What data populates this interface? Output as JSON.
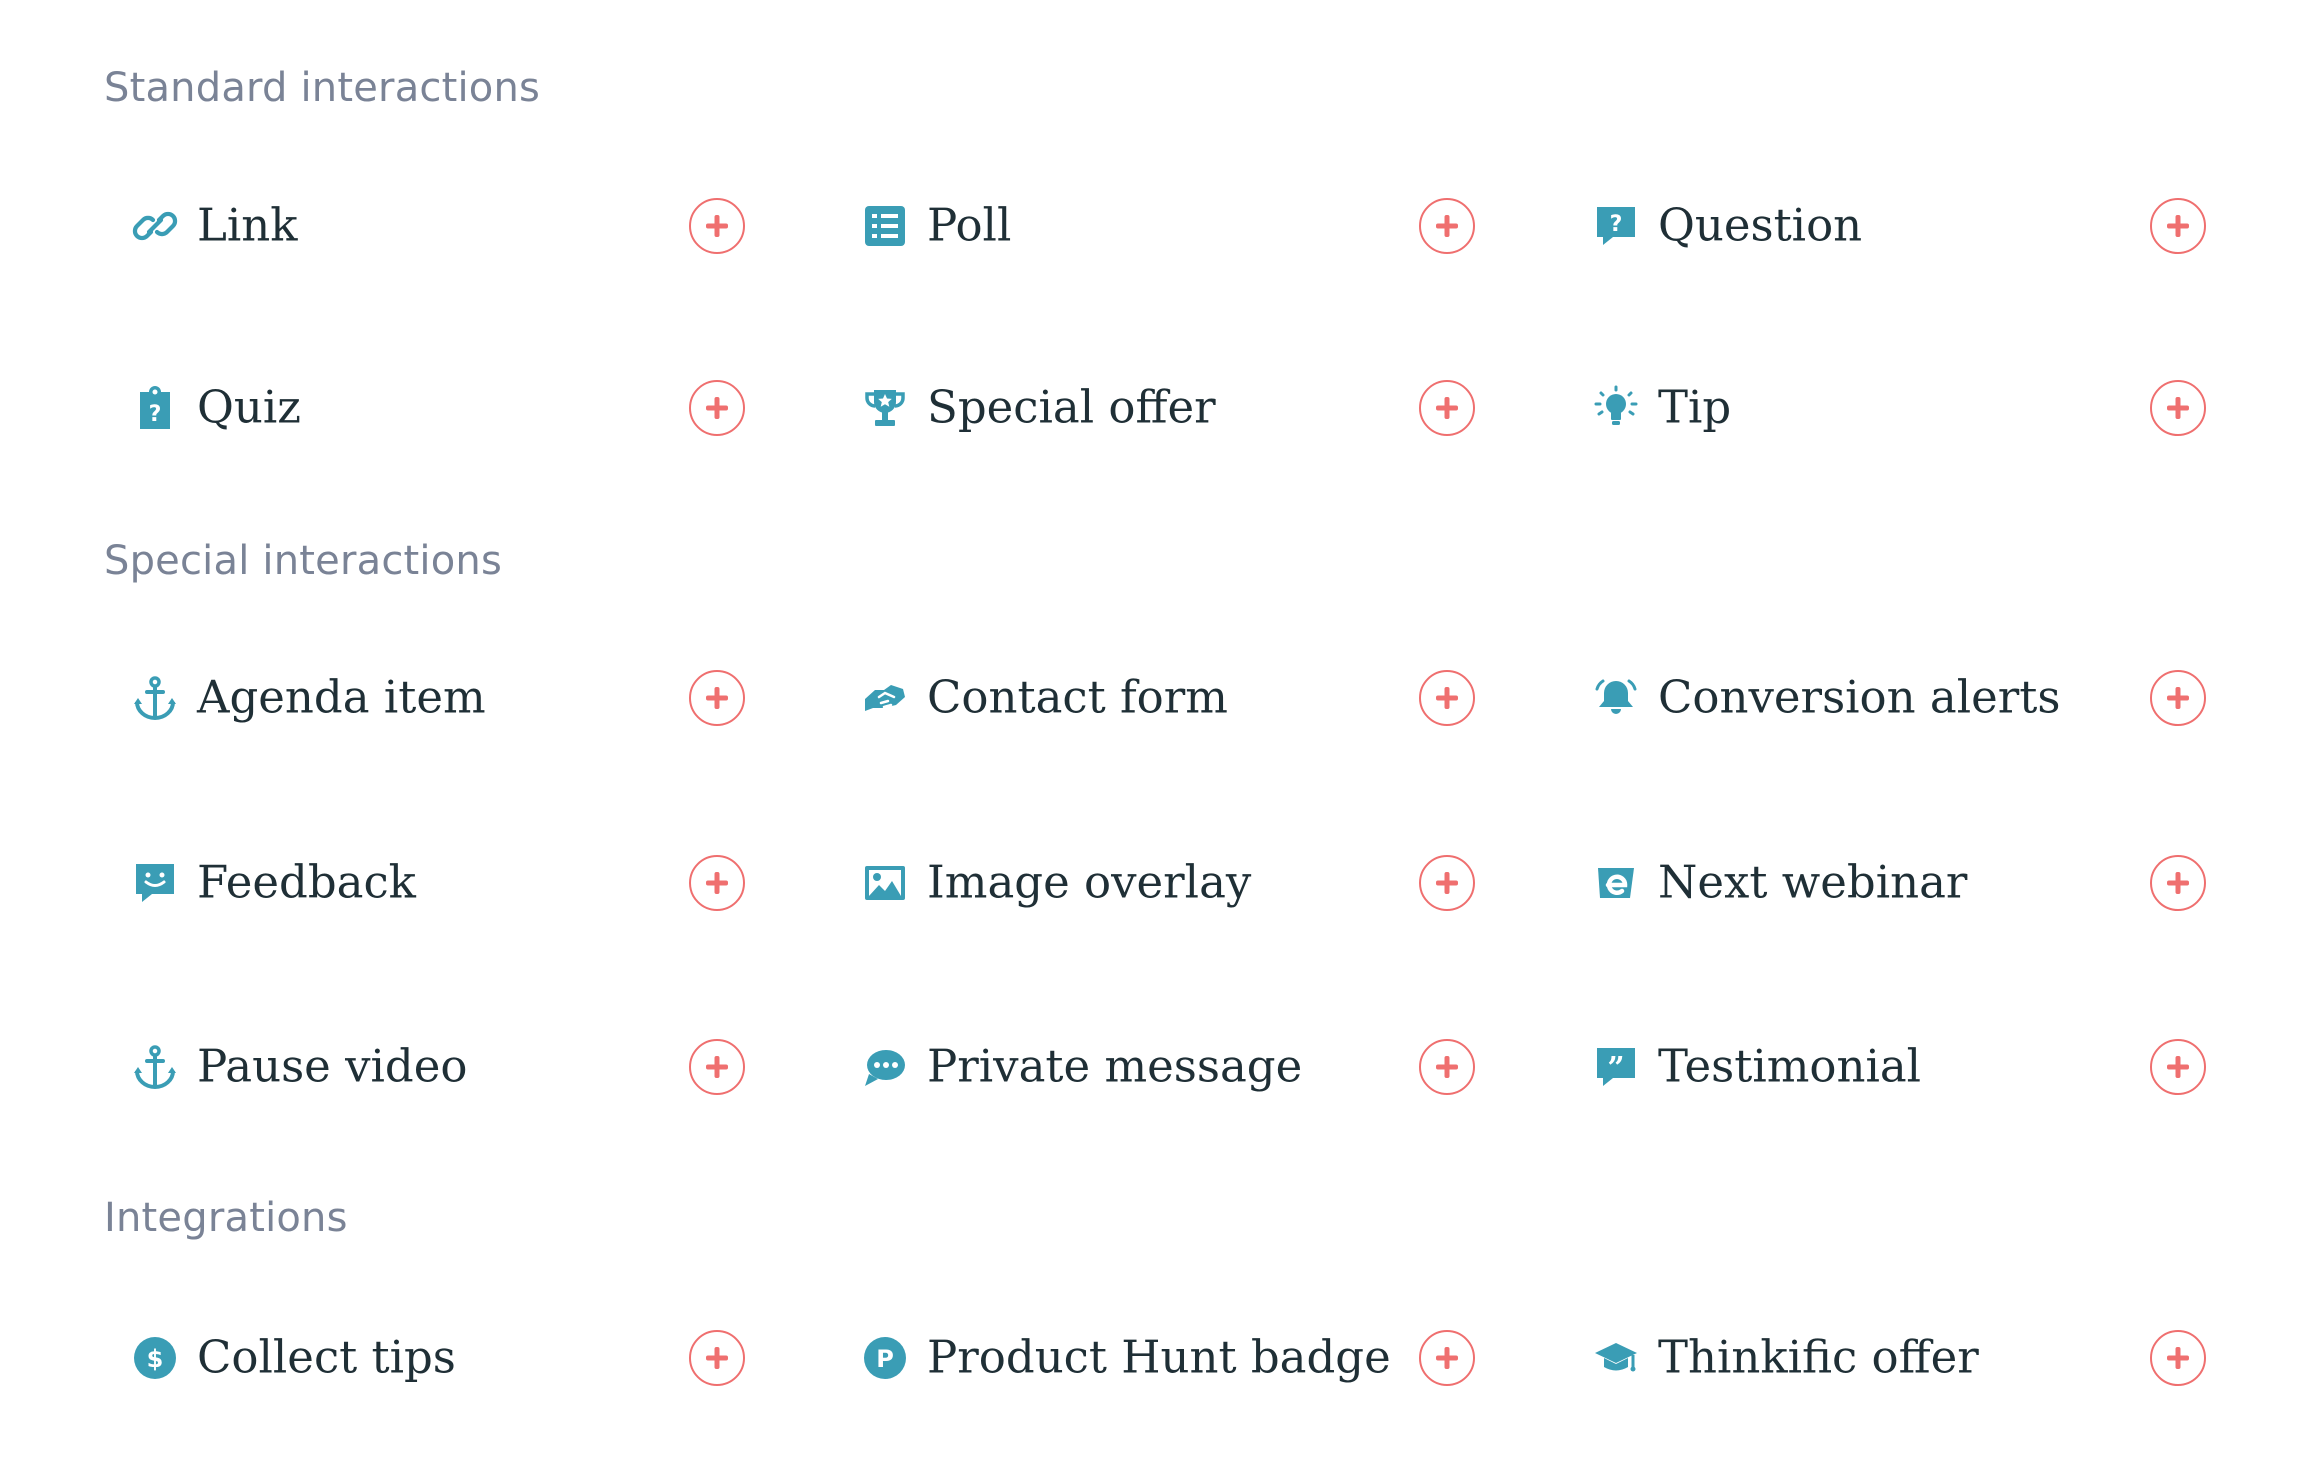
{
  "colors": {
    "icon": "#3a9db5",
    "add_button": "#ef6f6f",
    "section_title": "#7a8396",
    "label": "#1f2f36"
  },
  "sections": [
    {
      "title": "Standard interactions",
      "items": [
        {
          "label": "Link",
          "icon": "link-icon"
        },
        {
          "label": "Poll",
          "icon": "list-icon"
        },
        {
          "label": "Question",
          "icon": "question-bubble-icon"
        },
        {
          "label": "Quiz",
          "icon": "clipboard-question-icon"
        },
        {
          "label": "Special offer",
          "icon": "trophy-icon"
        },
        {
          "label": "Tip",
          "icon": "lightbulb-icon"
        }
      ]
    },
    {
      "title": "Special interactions",
      "items": [
        {
          "label": "Agenda item",
          "icon": "anchor-icon"
        },
        {
          "label": "Contact form",
          "icon": "handshake-icon"
        },
        {
          "label": "Conversion alerts",
          "icon": "bell-icon"
        },
        {
          "label": "Feedback",
          "icon": "smile-bubble-icon"
        },
        {
          "label": "Image overlay",
          "icon": "image-icon"
        },
        {
          "label": "Next webinar",
          "icon": "e-logo-icon"
        },
        {
          "label": "Pause video",
          "icon": "anchor-icon"
        },
        {
          "label": "Private message",
          "icon": "chat-dots-icon"
        },
        {
          "label": "Testimonial",
          "icon": "quote-bubble-icon"
        }
      ]
    },
    {
      "title": "Integrations",
      "items": [
        {
          "label": "Collect tips",
          "icon": "dollar-circle-icon"
        },
        {
          "label": "Product Hunt badge",
          "icon": "product-hunt-icon"
        },
        {
          "label": "Thinkific offer",
          "icon": "graduation-cap-icon"
        }
      ]
    }
  ]
}
